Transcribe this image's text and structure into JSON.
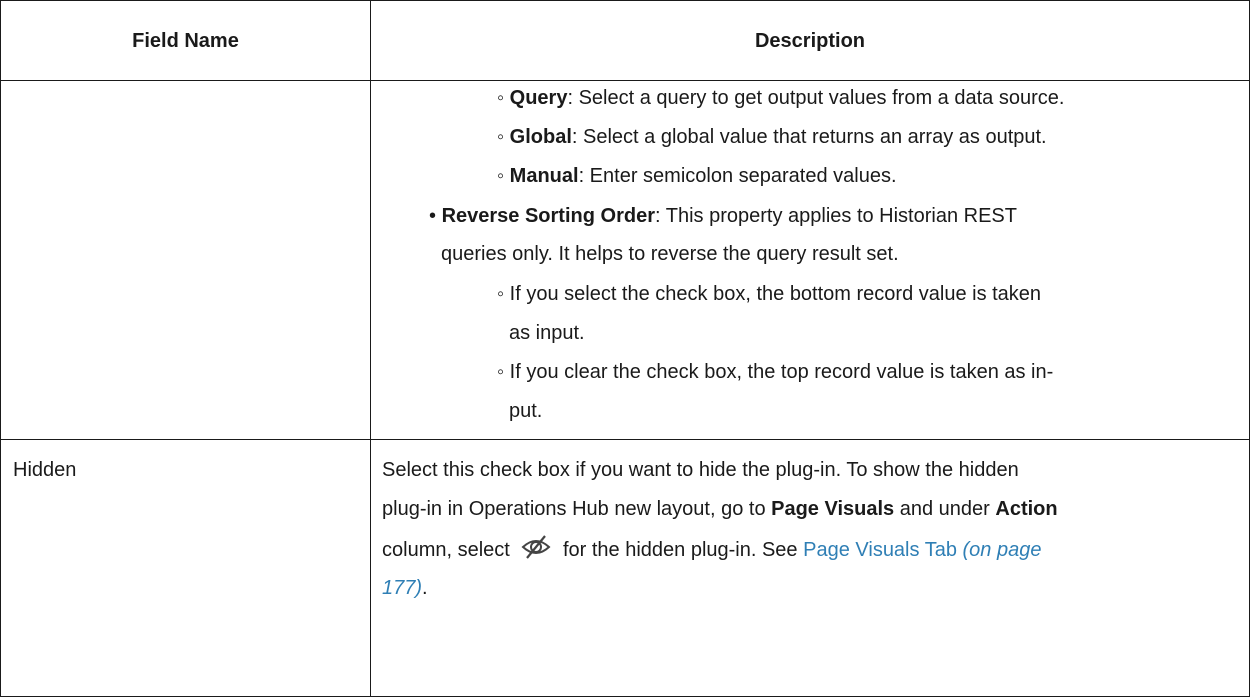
{
  "table": {
    "headers": {
      "field_name": "Field Name",
      "description": "Description"
    },
    "row1": {
      "field": "",
      "query_bold": "Query",
      "query_text": ": Select a query to get output values from a data source.",
      "global_bold": "Global",
      "global_text": ": Select a global value that returns an array as output.",
      "manual_bold": "Manual",
      "manual_text": ": Enter semicolon separated values.",
      "reverse_bold": "Reverse Sorting Order",
      "reverse_text_1": ": This property applies to Historian REST",
      "reverse_text_2": "queries only. It helps to reverse the query result set.",
      "select_text_1": "If you select the check box, the bottom record value is taken",
      "select_text_2": "as input.",
      "clear_text_1": "If you clear the check box, the top record value is taken as in-",
      "clear_text_2": "put."
    },
    "row2": {
      "field": "Hidden",
      "line1": "Select this check box if you want to hide the plug-in. To show the hidden",
      "line2_a": "plug-in in Operations Hub new layout, go to ",
      "line2_b_bold": "Page Visuals",
      "line2_c": " and under ",
      "line2_d_bold": "Action",
      "line3_a": "column, select ",
      "line3_b": " for the hidden plug-in. See ",
      "line3_link": "Page Visuals Tab",
      "line3_link_ref": " (on page",
      "line4_link_ref": "177)",
      "line4_end": ".",
      "icon": "eye-slash-icon"
    }
  }
}
